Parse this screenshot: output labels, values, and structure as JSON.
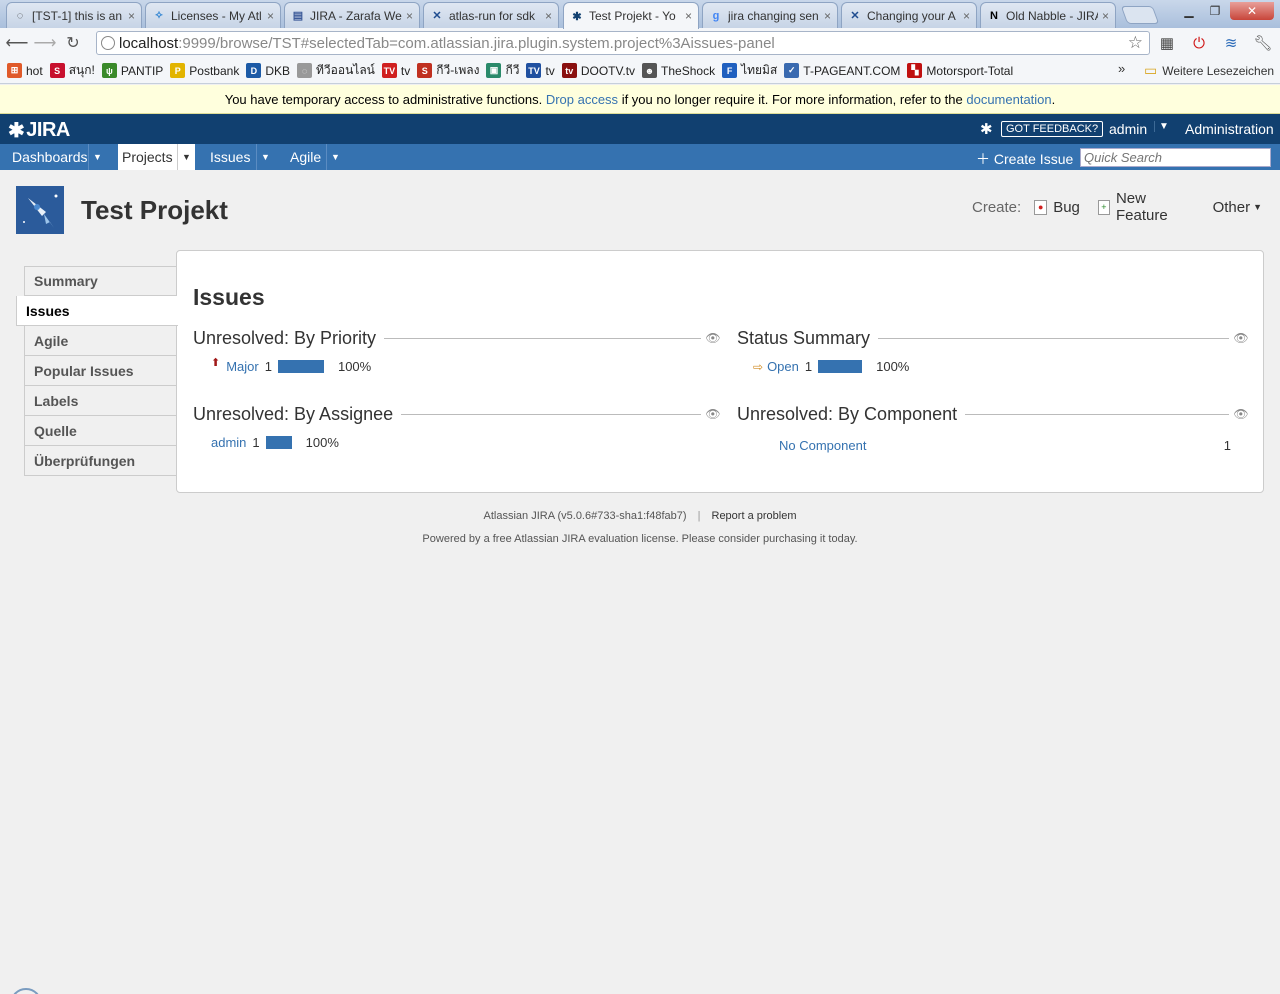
{
  "browser": {
    "tabs": [
      {
        "title": "[TST-1] this is an",
        "icon": "globe-icon",
        "icon_color": "#888888"
      },
      {
        "title": "Licenses - My Atl",
        "icon": "atlassian-icon",
        "icon_color": "#3d8bd4"
      },
      {
        "title": "JIRA - Zarafa Wel",
        "icon": "jira-doc-icon",
        "icon_color": "#3b5998"
      },
      {
        "title": "atlas-run for sdk",
        "icon": "atlassian-x-icon",
        "icon_color": "#1f4c8f"
      },
      {
        "title": "Test Projekt - Yo",
        "icon": "jira-icon",
        "icon_color": "#114070"
      },
      {
        "title": "jira changing sen",
        "icon": "google-icon",
        "icon_color": "#4285f4"
      },
      {
        "title": "Changing your A",
        "icon": "atlassian-x-icon",
        "icon_color": "#1f4c8f"
      },
      {
        "title": "Old Nabble - JIRA",
        "icon": "nabble-icon",
        "icon_color": "#000000"
      }
    ],
    "active_tab_index": 4,
    "url_host": "localhost",
    "url_rest": ":9999/browse/TST#selectedTab=com.atlassian.jira.plugin.system.project%3Aissues-panel",
    "bookmarks": [
      {
        "label": "hot",
        "icon": "windows-icon",
        "color": "#e05a2a"
      },
      {
        "label": "สนุก!",
        "icon": "sanook-icon",
        "color": "#c8102e"
      },
      {
        "label": "PANTIP",
        "icon": "cactus-icon",
        "color": "#3a8a2a"
      },
      {
        "label": "Postbank",
        "icon": "postbank-icon",
        "color": "#e2b400"
      },
      {
        "label": "DKB",
        "icon": "dkb-icon",
        "color": "#1c5aa6"
      },
      {
        "label": "ทีวีออนไลน์",
        "icon": "globe-icon",
        "color": "#999999"
      },
      {
        "label": "tv",
        "icon": "tv-icon",
        "color": "#d02020"
      },
      {
        "label": "กีวี-เพลง",
        "icon": "music-icon",
        "color": "#c03020"
      },
      {
        "label": "กีวี",
        "icon": "monitor-icon",
        "color": "#2a8a6a"
      },
      {
        "label": "tv",
        "icon": "tv-blue-icon",
        "color": "#2050a0"
      },
      {
        "label": "DOOTV.tv",
        "icon": "dootv-icon",
        "color": "#8a1010"
      },
      {
        "label": "TheShock",
        "icon": "theshock-icon",
        "color": "#555555"
      },
      {
        "label": "ไทยมิส",
        "icon": "f-icon",
        "color": "#1f5fbf"
      },
      {
        "label": "T-PAGEANT.COM",
        "icon": "pageant-icon",
        "color": "#3a6ab0"
      },
      {
        "label": "Motorsport-Total",
        "icon": "checkered-icon",
        "color": "#c01010"
      }
    ],
    "bookmarks_more": "»",
    "bookmarks_folder": "Weitere Lesezeichen"
  },
  "banner": {
    "text_before": "You have temporary access to administrative functions.",
    "drop_link": "Drop access",
    "text_middle": "if you no longer require it. For more information, refer to the",
    "doc_link": "documentation",
    "text_end": "."
  },
  "header": {
    "logo": "JIRA",
    "feedback": "GOT FEEDBACK?",
    "user": "admin",
    "admin": "Administration"
  },
  "nav": {
    "items": [
      "Dashboards",
      "Projects",
      "Issues",
      "Agile"
    ],
    "selected_index": 1,
    "create_issue": "Create Issue",
    "search_placeholder": "Quick Search"
  },
  "project": {
    "title": "Test Projekt",
    "create_label": "Create:",
    "create_items": [
      "Bug",
      "New Feature",
      "Other"
    ]
  },
  "sidebar": {
    "tabs": [
      "Summary",
      "Issues",
      "Agile",
      "Popular Issues",
      "Labels",
      "Quelle",
      "Überprüfungen"
    ],
    "active_index": 1
  },
  "panel": {
    "title": "Issues",
    "priority": {
      "title": "Unresolved: By Priority",
      "rows": [
        {
          "label": "Major",
          "count": "1",
          "percent": "100%",
          "fraction": 1.0
        }
      ]
    },
    "status": {
      "title": "Status Summary",
      "rows": [
        {
          "label": "Open",
          "count": "1",
          "percent": "100%",
          "fraction": 1.0
        }
      ]
    },
    "assignee": {
      "title": "Unresolved: By Assignee",
      "rows": [
        {
          "label": "admin",
          "count": "1",
          "percent": "100%",
          "fraction": 1.0
        }
      ]
    },
    "component": {
      "title": "Unresolved: By Component",
      "rows": [
        {
          "label": "No Component",
          "count": "1"
        }
      ]
    }
  },
  "footer": {
    "version": "Atlassian JIRA (v5.0.6#733-sha1:f48fab7)",
    "separator": "|",
    "report": "Report a problem",
    "license": "Powered by a free Atlassian JIRA evaluation license. Please consider purchasing it today."
  }
}
